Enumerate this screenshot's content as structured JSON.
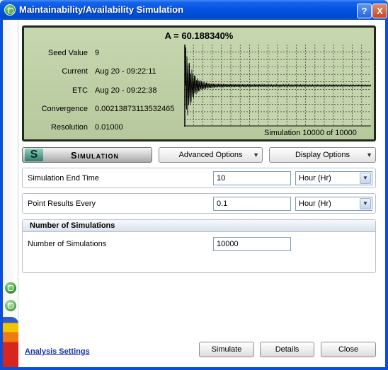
{
  "window": {
    "title": "Maintainability/Availability Simulation",
    "help_label": "?",
    "close_label": "X"
  },
  "display": {
    "availability": "A = 60.188340%",
    "stats": [
      {
        "label": "Seed Value",
        "value": "9"
      },
      {
        "label": "Current",
        "value": "Aug 20 - 09:22:11"
      },
      {
        "label": "ETC",
        "value": "Aug 20 - 09:22:38"
      },
      {
        "label": "Convergence",
        "value": "0.00213873113532465"
      },
      {
        "label": "Resolution",
        "value": "0.01000"
      }
    ],
    "simulation_count": "Simulation 10000 of 10000"
  },
  "toolbar": {
    "sim_letter": "S",
    "sim_label": "Simulation",
    "advanced_options": "Advanced Options",
    "display_options": "Display Options"
  },
  "end_time": {
    "label": "Simulation End Time",
    "value": "10",
    "unit": "Hour (Hr)"
  },
  "point_results": {
    "label": "Point Results Every",
    "value": "0.1",
    "unit": "Hour (Hr)"
  },
  "num_sims": {
    "header": "Number of Simulations",
    "label": "Number of Simulations",
    "value": "10000"
  },
  "footer": {
    "link": "Analysis Settings",
    "simulate": "Simulate",
    "details": "Details",
    "close": "Close"
  },
  "colors": {
    "title_bar": "#0054e3",
    "display_bg": "#bfcfa6",
    "display_frame": "#1b2a1b",
    "link": "#1a2fb0"
  }
}
